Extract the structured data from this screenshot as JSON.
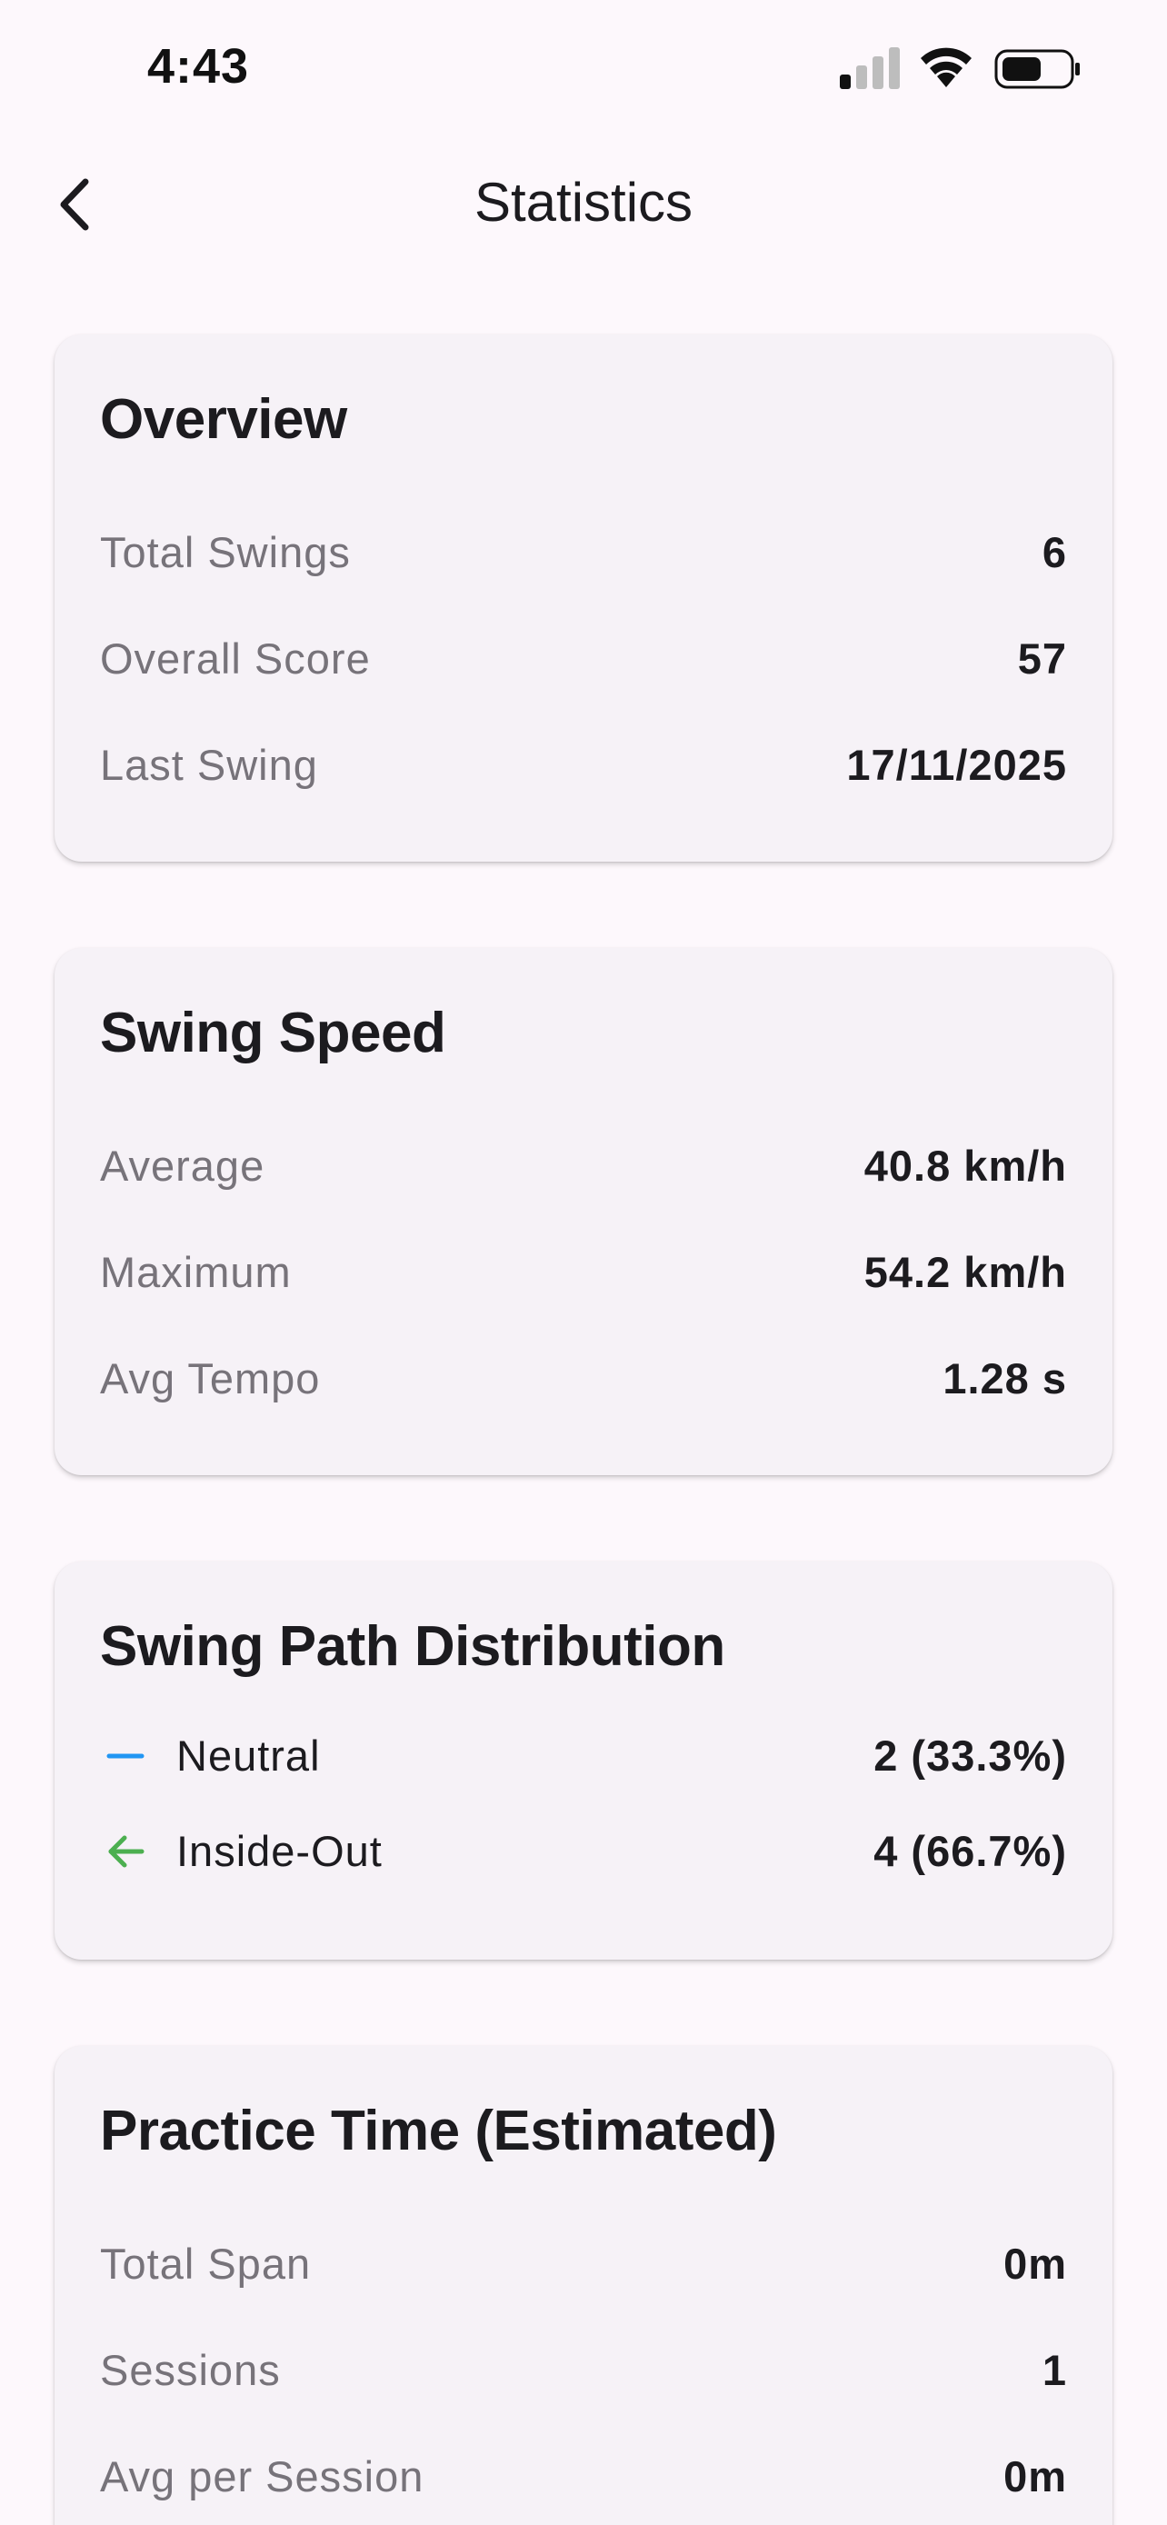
{
  "status_bar": {
    "time": "4:43",
    "icons": [
      "signal-icon",
      "wifi-icon",
      "battery-icon"
    ]
  },
  "app_bar": {
    "title": "Statistics",
    "back_icon": "chevron-left-icon"
  },
  "overview": {
    "title": "Overview",
    "rows": [
      {
        "label": "Total Swings",
        "value": "6"
      },
      {
        "label": "Overall Score",
        "value": "57"
      },
      {
        "label": "Last Swing",
        "value": "17/11/2025"
      }
    ]
  },
  "swing_speed": {
    "title": "Swing Speed",
    "rows": [
      {
        "label": "Average",
        "value": "40.8 km/h"
      },
      {
        "label": "Maximum",
        "value": "54.2 km/h"
      },
      {
        "label": "Avg Tempo",
        "value": "1.28 s"
      }
    ]
  },
  "swing_path": {
    "title": "Swing Path Distribution",
    "rows": [
      {
        "icon": "minus-icon",
        "color": "#2196f3",
        "label": "Neutral",
        "value": "2 (33.3%)"
      },
      {
        "icon": "arrow-left-icon",
        "color": "#4caf50",
        "label": "Inside-Out",
        "value": "4 (66.7%)"
      }
    ]
  },
  "practice_time": {
    "title": "Practice Time (Estimated)",
    "rows": [
      {
        "label": "Total Span",
        "value": "0m"
      },
      {
        "label": "Sessions",
        "value": "1"
      },
      {
        "label": "Avg per Session",
        "value": "0m"
      }
    ]
  },
  "colors": {
    "background": "#fdf8fc",
    "card": "#f6f2f7",
    "label": "#77737a",
    "text": "#1c1b1f"
  }
}
